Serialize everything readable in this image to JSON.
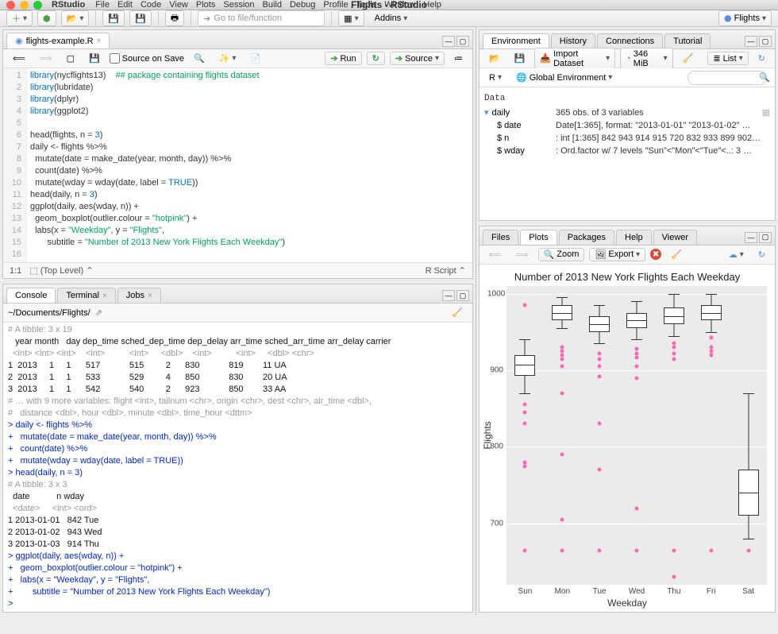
{
  "app": {
    "name": "RStudio",
    "title": "Flights - RStudio"
  },
  "menubar": [
    "File",
    "Edit",
    "Code",
    "View",
    "Plots",
    "Session",
    "Build",
    "Debug",
    "Profile",
    "Tools",
    "Window",
    "Help"
  ],
  "toolbar": {
    "gotofile": "Go to file/function",
    "addins": "Addins",
    "project": "Flights"
  },
  "source": {
    "filename": "flights-example.R",
    "source_on_save": "Source on Save",
    "run": "Run",
    "source": "Source",
    "status_left": "1:1",
    "status_mid": "(Top Level)",
    "status_right": "R Script",
    "lines": [
      {
        "n": 1,
        "html": "<span class='kw'>library</span>(nycflights13)    <span class='cmt'>## package containing flights dataset</span>"
      },
      {
        "n": 2,
        "html": "<span class='kw'>library</span>(lubridate)"
      },
      {
        "n": 3,
        "html": "<span class='kw'>library</span>(dplyr)"
      },
      {
        "n": 4,
        "html": "<span class='kw'>library</span>(ggplot2)"
      },
      {
        "n": 5,
        "html": ""
      },
      {
        "n": 6,
        "html": "head(flights, <span class='arg'>n</span> = <span class='num'>3</span>)"
      },
      {
        "n": 7,
        "html": "daily &lt;- flights %&gt;%"
      },
      {
        "n": 8,
        "html": "  mutate(<span class='arg'>date</span> = make_date(year, month, day)) %&gt;%"
      },
      {
        "n": 9,
        "html": "  count(date) %&gt;%"
      },
      {
        "n": 10,
        "html": "  mutate(<span class='arg'>wday</span> = wday(date, <span class='arg'>label</span> = <span class='num'>TRUE</span>))"
      },
      {
        "n": 11,
        "html": "head(daily, <span class='arg'>n</span> = <span class='num'>3</span>)"
      },
      {
        "n": 12,
        "html": "ggplot(daily, aes(wday, n)) +"
      },
      {
        "n": 13,
        "html": "  geom_boxplot(<span class='arg'>outlier.colour</span> = <span class='str'>\"hotpink\"</span>) +"
      },
      {
        "n": 14,
        "html": "  labs(<span class='arg'>x</span> = <span class='str'>\"Weekday\"</span>, <span class='arg'>y</span> = <span class='str'>\"Flights\"</span>,"
      },
      {
        "n": 15,
        "html": "       <span class='arg'>subtitle</span> = <span class='str'>\"Number of 2013 New York Flights Each Weekday\"</span>)"
      },
      {
        "n": 16,
        "html": ""
      }
    ]
  },
  "console": {
    "tabs": [
      "Console",
      "Terminal",
      "Jobs"
    ],
    "path": "~/Documents/Flights/",
    "lines": [
      {
        "cls": "c-gray",
        "t": "# A tibble: 3 x 19"
      },
      {
        "cls": "c-black",
        "t": "   year month   day dep_time sched_dep_time dep_delay arr_time sched_arr_time arr_delay carrier"
      },
      {
        "cls": "c-gray",
        "t": "  <int> <int> <int>    <int>          <int>     <dbl>    <int>          <int>     <dbl> <chr>  "
      },
      {
        "cls": "c-black",
        "t": "1  2013     1     1      517            515         2      830            819        11 UA     "
      },
      {
        "cls": "c-black",
        "t": "2  2013     1     1      533            529         4      850            830        20 UA     "
      },
      {
        "cls": "c-black",
        "t": "3  2013     1     1      542            540         2      923            850        33 AA     "
      },
      {
        "cls": "c-gray",
        "t": "# … with 9 more variables: flight <int>, tailnum <chr>, origin <chr>, dest <chr>, air_time <dbl>,"
      },
      {
        "cls": "c-gray",
        "t": "#   distance <dbl>, hour <dbl>, minute <dbl>, time_hour <dttm>"
      },
      {
        "cls": "c-blue",
        "t": "> daily <- flights %>%"
      },
      {
        "cls": "c-blue",
        "t": "+   mutate(date = make_date(year, month, day)) %>%"
      },
      {
        "cls": "c-blue",
        "t": "+   count(date) %>%"
      },
      {
        "cls": "c-blue",
        "t": "+   mutate(wday = wday(date, label = TRUE))"
      },
      {
        "cls": "c-blue",
        "t": "> head(daily, n = 3)"
      },
      {
        "cls": "c-gray",
        "t": "# A tibble: 3 x 3"
      },
      {
        "cls": "c-black",
        "t": "  date           n wday "
      },
      {
        "cls": "c-gray",
        "t": "  <date>     <int> <ord>"
      },
      {
        "cls": "c-black",
        "t": "1 2013-01-01   842 Tue  "
      },
      {
        "cls": "c-black",
        "t": "2 2013-01-02   943 Wed  "
      },
      {
        "cls": "c-black",
        "t": "3 2013-01-03   914 Thu  "
      },
      {
        "cls": "c-blue",
        "t": "> ggplot(daily, aes(wday, n)) +"
      },
      {
        "cls": "c-blue",
        "t": "+   geom_boxplot(outlier.colour = \"hotpink\") +"
      },
      {
        "cls": "c-blue",
        "t": "+   labs(x = \"Weekday\", y = \"Flights\","
      },
      {
        "cls": "c-blue",
        "t": "+        subtitle = \"Number of 2013 New York Flights Each Weekday\")"
      },
      {
        "cls": "c-blue",
        "t": "> "
      }
    ]
  },
  "env": {
    "tabs": [
      "Environment",
      "History",
      "Connections",
      "Tutorial"
    ],
    "import": "Import Dataset",
    "mem": "346 MiB",
    "view": "List",
    "scope": "Global Environment",
    "r": "R",
    "data_label": "Data",
    "object": "daily",
    "object_desc": "365 obs. of 3 variables",
    "vars": [
      {
        "name": "$ date",
        "desc": "Date[1:365], format: \"2013-01-01\" \"2013-01-02\" …"
      },
      {
        "name": "$ n",
        "desc": ": int [1:365] 842 943 914 915 720 832 933 899 902…"
      },
      {
        "name": "$ wday",
        "desc": ": Ord.factor w/ 7 levels \"Sun\"<\"Mon\"<\"Tue\"<..: 3 …"
      }
    ]
  },
  "plots": {
    "tabs": [
      "Files",
      "Plots",
      "Packages",
      "Help",
      "Viewer"
    ],
    "zoom": "Zoom",
    "export": "Export",
    "title": "Number of 2013 New York Flights Each Weekday",
    "xlab": "Weekday",
    "ylab": "Flights",
    "yticks": [
      700,
      800,
      900,
      1000
    ],
    "xticks": [
      "Sun",
      "Mon",
      "Tue",
      "Wed",
      "Thu",
      "Fri",
      "Sat"
    ]
  },
  "chart_data": {
    "type": "boxplot",
    "title": "Number of 2013 New York Flights Each Weekday",
    "xlabel": "Weekday",
    "ylabel": "Flights",
    "ylim": [
      620,
      1010
    ],
    "categories": [
      "Sun",
      "Mon",
      "Tue",
      "Wed",
      "Thu",
      "Fri",
      "Sat"
    ],
    "boxes": [
      {
        "low": 870,
        "q1": 893,
        "med": 907,
        "q3": 920,
        "high": 940,
        "outliers": [
          665,
          775,
          780,
          830,
          845,
          855,
          985
        ]
      },
      {
        "low": 955,
        "q1": 965,
        "med": 975,
        "q3": 985,
        "high": 995,
        "outliers": [
          665,
          705,
          790,
          870,
          905,
          915,
          920,
          925,
          930
        ]
      },
      {
        "low": 935,
        "q1": 950,
        "med": 960,
        "q3": 970,
        "high": 985,
        "outliers": [
          665,
          770,
          830,
          892,
          905,
          915,
          922
        ]
      },
      {
        "low": 940,
        "q1": 955,
        "med": 965,
        "q3": 975,
        "high": 990,
        "outliers": [
          665,
          720,
          890,
          905,
          917,
          922,
          928
        ]
      },
      {
        "low": 945,
        "q1": 960,
        "med": 970,
        "q3": 982,
        "high": 1000,
        "outliers": [
          630,
          665,
          915,
          922,
          930,
          935
        ]
      },
      {
        "low": 950,
        "q1": 965,
        "med": 975,
        "q3": 985,
        "high": 1000,
        "outliers": [
          665,
          920,
          925,
          930,
          942
        ]
      },
      {
        "low": 680,
        "q1": 710,
        "med": 740,
        "q3": 770,
        "high": 870,
        "outliers": [
          665
        ]
      }
    ],
    "outlier_color": "#ff69b4"
  }
}
